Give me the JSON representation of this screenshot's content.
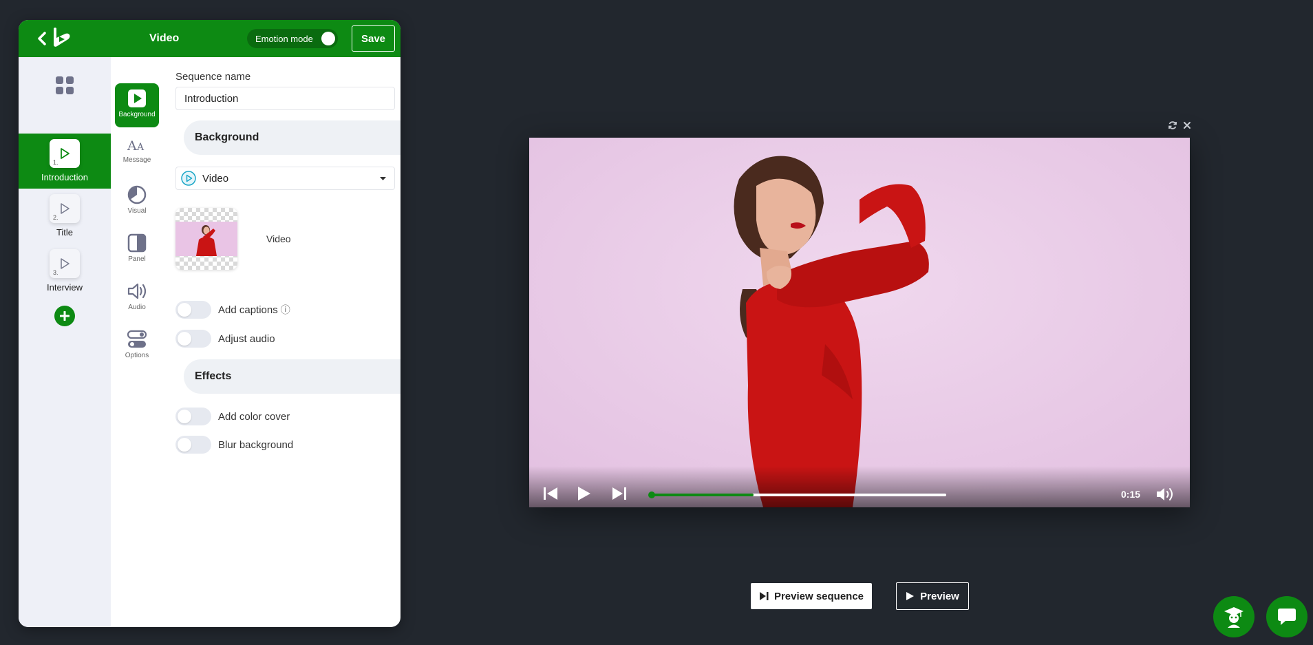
{
  "header": {
    "title": "Video",
    "emotion_mode_label": "Emotion mode",
    "save_label": "Save"
  },
  "sequences": [
    {
      "number": "1.",
      "label": "Introduction",
      "active": true
    },
    {
      "number": "2.",
      "label": "Title",
      "active": false
    },
    {
      "number": "3.",
      "label": "Interview",
      "active": false
    }
  ],
  "tools": [
    {
      "label": "Background",
      "icon": "play-square-icon",
      "active": true
    },
    {
      "label": "Message",
      "icon": "text-aa-icon",
      "active": false
    },
    {
      "label": "Visual",
      "icon": "pie-icon",
      "active": false
    },
    {
      "label": "Panel",
      "icon": "panel-icon",
      "active": false
    },
    {
      "label": "Audio",
      "icon": "speaker-icon",
      "active": false
    },
    {
      "label": "Options",
      "icon": "toggles-icon",
      "active": false
    }
  ],
  "form": {
    "sequence_name_label": "Sequence name",
    "sequence_name_value": "Introduction",
    "background_heading": "Background",
    "background_type": "Video",
    "media_label": "Video",
    "add_captions_label": "Add captions",
    "adjust_audio_label": "Adjust audio",
    "effects_heading": "Effects",
    "add_color_cover_label": "Add color cover",
    "blur_background_label": "Blur background"
  },
  "player": {
    "time": "0:15",
    "progress": 0.345
  },
  "buttons": {
    "preview_sequence": "Preview sequence",
    "preview": "Preview"
  },
  "colors": {
    "brand_green": "#0d8a13",
    "page_bg": "#22272e",
    "video_bg": "#e8c8e4",
    "sweater_red": "#c91414"
  }
}
